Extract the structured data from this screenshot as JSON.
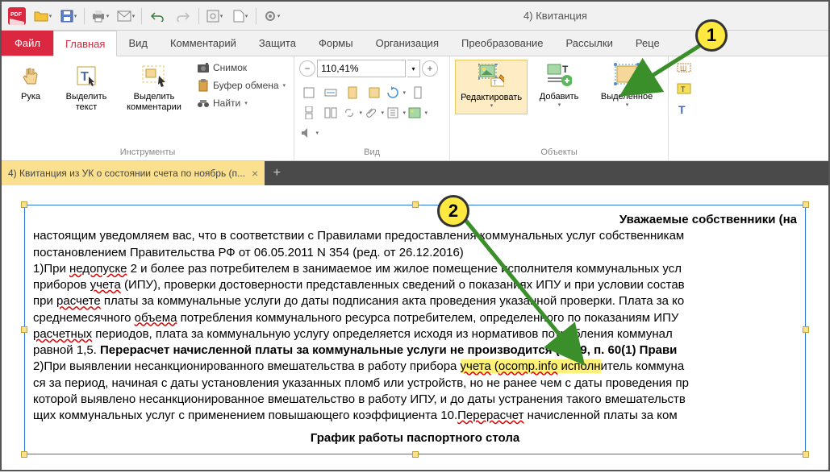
{
  "window_title": "4) Квитанция",
  "qat": {
    "open_caret": "▾",
    "save_caret": "▾",
    "print_caret": "▾",
    "mail_caret": "▾"
  },
  "tabs": {
    "file": "Файл",
    "items": [
      "Главная",
      "Вид",
      "Комментарий",
      "Защита",
      "Формы",
      "Организация",
      "Преобразование",
      "Рассылки",
      "Реце"
    ]
  },
  "ribbon": {
    "tools_group_label": "Инструменты",
    "hand": "Рука",
    "select_text": "Выделить\nтекст",
    "select_comments": "Выделить\nкомментарии",
    "snapshot": "Снимок",
    "clipboard": "Буфер обмена",
    "find": "Найти",
    "view_group_label": "Вид",
    "zoom_value": "110,41%",
    "objects_group_label": "Объекты",
    "edit": "Редактировать",
    "add": "Добавить",
    "selection": "Выделенное",
    "form_label": "Ш"
  },
  "doctab": {
    "title": "4) Квитанция из УК о состоянии счета по ноябрь (п..."
  },
  "document": {
    "heading1": "Уважаемые собственники (на",
    "p1a": "настоящим уведомляем вас, что в соответствии с Правилами предоставления коммунальных услуг собственникам",
    "p1b": "постановлением Правительства РФ от 06.05.2011 N 354 (ред. от 26.12.2016)",
    "p2a": "1)При ",
    "p2_u1": "недопуске",
    "p2b": " 2 и более раз потребителем в занимаемое им жилое помещение исполнителя коммунальных усл",
    "p3a": "приборов ",
    "p3_u1": "учета",
    "p3b": " (ИПУ), проверки достоверности представленных сведений о показаниях ИПУ и при условии состав",
    "p4a": "при ",
    "p4_u1": "расчете",
    "p4b": " платы за коммунальные услуги до даты подписания акта проведения указанной проверки. Плата за ко",
    "p5a": "среднемесячного ",
    "p5_u1": "объема",
    "p5b": " потребления коммунального ресурса потребителем, определенного по показаниям ИПУ ",
    "p6a": "",
    "p6_u1": "расчетных",
    "p6b": " периодов, плата за коммунальную услугу определяется исходя из нормативов потребления коммунал",
    "p7a": "равной 1,5. ",
    "p7_bold": "Перерасчет начисленной платы за коммунальные услуги не производится (п. 59, п. 60(1) Прави",
    "p8a": "2)При выявлении несанкционированного вмешательства в работу прибора ",
    "p8_hl1": "учета",
    "p8_hl2": " (",
    "p8_hl3": "ocomp.info",
    "p8_hl4": " исполн",
    "p8b": "итель коммуна",
    "p9": "ся за период, начиная с даты установления указанных пломб или устройств, но не ранее чем с даты проведения пр",
    "p10a": "которой выявлено несанкционированное вмешательство в работу ИПУ, и до даты устранения такого вмешательств",
    "p11a": "щих коммунальных услуг с применением повышающего коэффициента 10.",
    "p11_u1": "Перерасчет",
    "p11b": " начисленной платы за ком",
    "heading2": "График работы паспортного стола"
  },
  "callouts": {
    "one": "1",
    "two": "2"
  }
}
